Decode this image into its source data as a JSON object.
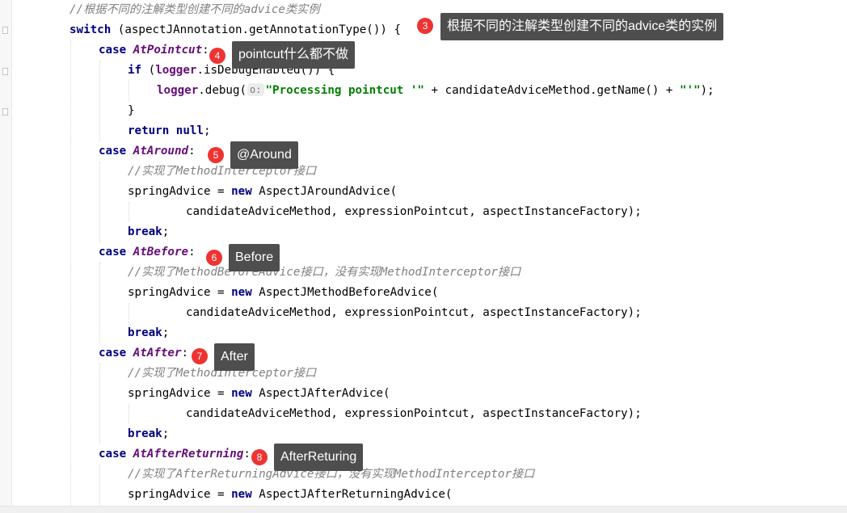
{
  "code_lines": [
    {
      "indent": 0,
      "tokens": [
        {
          "t": "//根据不同的注解类型创建不同的advice类实例",
          "c": "cm"
        }
      ]
    },
    {
      "indent": 0,
      "tokens": [
        {
          "t": "switch",
          "c": "kw"
        },
        {
          "t": " (aspectJAnnotation.getAnnotationType()) {"
        }
      ]
    },
    {
      "indent": 1,
      "tokens": [
        {
          "t": "case ",
          "c": "kw"
        },
        {
          "t": "AtPointcut",
          "c": "en"
        },
        {
          "t": ":"
        }
      ]
    },
    {
      "indent": 2,
      "tokens": [
        {
          "t": "if",
          "c": "kw"
        },
        {
          "t": " ("
        },
        {
          "t": "logger",
          "c": "fld"
        },
        {
          "t": ".isDebugEnabled()) {"
        }
      ]
    },
    {
      "indent": 3,
      "tokens": [
        {
          "t": "logger",
          "c": "fld"
        },
        {
          "t": ".debug("
        },
        {
          "t": "o:",
          "c": "hint"
        },
        {
          "t": "\"Processing pointcut '\"",
          "c": "str"
        },
        {
          "t": " + candidateAdviceMethod.getName() + "
        },
        {
          "t": "\"'\"",
          "c": "str"
        },
        {
          "t": ");"
        }
      ]
    },
    {
      "indent": 2,
      "tokens": [
        {
          "t": "}"
        }
      ]
    },
    {
      "indent": 2,
      "tokens": [
        {
          "t": "return null",
          "c": "kw"
        },
        {
          "t": ";"
        }
      ]
    },
    {
      "indent": 1,
      "tokens": [
        {
          "t": "case ",
          "c": "kw"
        },
        {
          "t": "AtAround",
          "c": "en"
        },
        {
          "t": ":"
        }
      ]
    },
    {
      "indent": 2,
      "tokens": [
        {
          "t": "//实现了MethodInterceptor接口",
          "c": "cm"
        }
      ]
    },
    {
      "indent": 2,
      "tokens": [
        {
          "t": "springAdvice = "
        },
        {
          "t": "new",
          "c": "kw"
        },
        {
          "t": " AspectJAroundAdvice("
        }
      ]
    },
    {
      "indent": 4,
      "tokens": [
        {
          "t": "candidateAdviceMethod, expressionPointcut, aspectInstanceFactory);"
        }
      ]
    },
    {
      "indent": 2,
      "tokens": [
        {
          "t": "break",
          "c": "kw"
        },
        {
          "t": ";"
        }
      ]
    },
    {
      "indent": 1,
      "tokens": [
        {
          "t": "case ",
          "c": "kw"
        },
        {
          "t": "AtBefore",
          "c": "en"
        },
        {
          "t": ":"
        }
      ]
    },
    {
      "indent": 2,
      "tokens": [
        {
          "t": "//实现了MethodBeforeAdvice接口，没有实现MethodInterceptor接口",
          "c": "cm"
        }
      ]
    },
    {
      "indent": 2,
      "tokens": [
        {
          "t": "springAdvice = "
        },
        {
          "t": "new",
          "c": "kw"
        },
        {
          "t": " AspectJMethodBeforeAdvice("
        }
      ]
    },
    {
      "indent": 4,
      "tokens": [
        {
          "t": "candidateAdviceMethod, expressionPointcut, aspectInstanceFactory);"
        }
      ]
    },
    {
      "indent": 2,
      "tokens": [
        {
          "t": "break",
          "c": "kw"
        },
        {
          "t": ";"
        }
      ]
    },
    {
      "indent": 1,
      "tokens": [
        {
          "t": "case ",
          "c": "kw"
        },
        {
          "t": "AtAfter",
          "c": "en"
        },
        {
          "t": ":"
        }
      ]
    },
    {
      "indent": 2,
      "tokens": [
        {
          "t": "//实现了MethodInterceptor接口",
          "c": "cm"
        }
      ]
    },
    {
      "indent": 2,
      "tokens": [
        {
          "t": "springAdvice = "
        },
        {
          "t": "new",
          "c": "kw"
        },
        {
          "t": " AspectJAfterAdvice("
        }
      ]
    },
    {
      "indent": 4,
      "tokens": [
        {
          "t": "candidateAdviceMethod, expressionPointcut, aspectInstanceFactory);"
        }
      ]
    },
    {
      "indent": 2,
      "tokens": [
        {
          "t": "break",
          "c": "kw"
        },
        {
          "t": ";"
        }
      ]
    },
    {
      "indent": 1,
      "tokens": [
        {
          "t": "case ",
          "c": "kw"
        },
        {
          "t": "AtAfterReturning",
          "c": "en"
        },
        {
          "t": ":"
        }
      ]
    },
    {
      "indent": 2,
      "tokens": [
        {
          "t": "//实现了AfterReturningAdvice接口，没有实现MethodInterceptor接口",
          "c": "cm"
        }
      ]
    },
    {
      "indent": 2,
      "tokens": [
        {
          "t": "springAdvice = "
        },
        {
          "t": "new",
          "c": "kw"
        },
        {
          "t": " AspectJAfterReturningAdvice("
        }
      ]
    }
  ],
  "annotations": [
    {
      "number": "3",
      "text": "根据不同的注解类型创建不同的advice类的实例"
    },
    {
      "number": "4",
      "text": "pointcut什么都不做"
    },
    {
      "number": "5",
      "text": "@Around"
    },
    {
      "number": "6",
      "text": "Before"
    },
    {
      "number": "7",
      "text": "After"
    },
    {
      "number": "8",
      "text": "AfterReturing"
    }
  ]
}
